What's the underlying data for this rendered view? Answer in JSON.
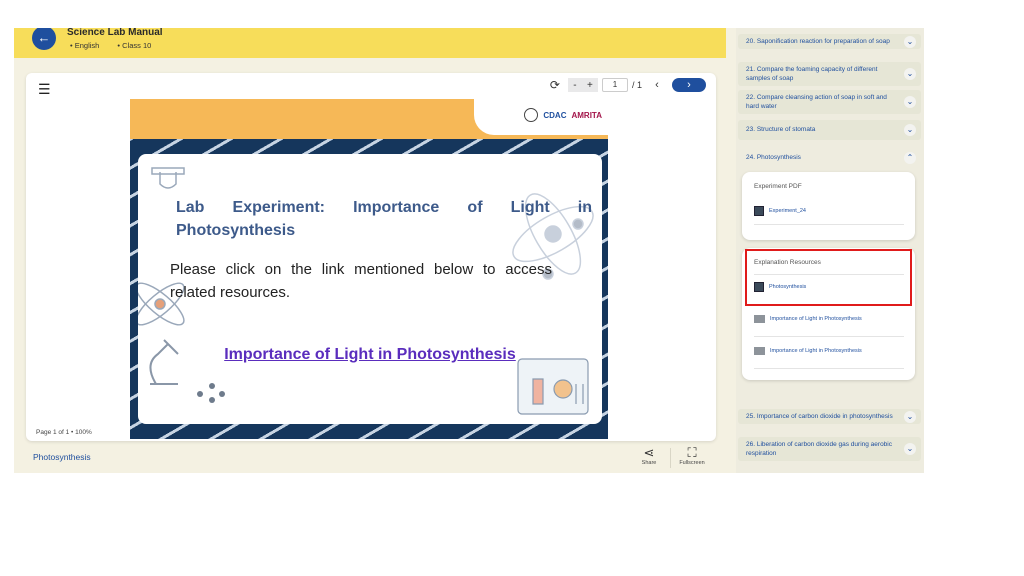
{
  "header": {
    "title": "Science Lab Manual",
    "language": "English",
    "class": "Class 10",
    "back_icon": "arrow-left-icon"
  },
  "toolbar": {
    "zoom_out": "-",
    "zoom_in": "+",
    "page_value": "1",
    "page_total": "/ 1",
    "prev": "‹",
    "next": "›"
  },
  "slide": {
    "logos": [
      "CDAC",
      "AMRITA"
    ],
    "heading": "Lab Experiment: Importance of Light in Photosynthesis",
    "body": "Please click on the link mentioned below to access related resources.",
    "link": "Importance of Light in Photosynthesis"
  },
  "viewer": {
    "page_info": "Page 1 of 1  •  100%"
  },
  "footer": {
    "title": "Photosynthesis",
    "share": "Share",
    "fullscreen": "Fullscreen"
  },
  "sidebar": {
    "items_top": [
      {
        "label": "20. Saponification reaction for preparation of soap"
      },
      {
        "label": "21. Compare the foaming capacity of different samples of soap"
      },
      {
        "label": "22. Compare cleansing action of soap in soft and hard water"
      },
      {
        "label": "23. Structure of stomata"
      },
      {
        "label": "24. Photosynthesis"
      }
    ],
    "expanded": {
      "pdf_title": "Experiment PDF",
      "pdf_item": "Experiment_24",
      "expl_title": "Explanation Resources",
      "expl_item": "Photosynthesis",
      "video_items": [
        "Importance of Light in Photosynthesis",
        "Importance of Light in Photosynthesis"
      ]
    },
    "items_bottom": [
      {
        "label": "25. Importance of carbon dioxide in photosynthesis"
      },
      {
        "label": "26. Liberation of carbon dioxide gas during aerobic respiration"
      }
    ]
  },
  "colors": {
    "accent": "#1f4f9e",
    "header": "#f7dd5a",
    "highlight": "#e01b1b"
  }
}
